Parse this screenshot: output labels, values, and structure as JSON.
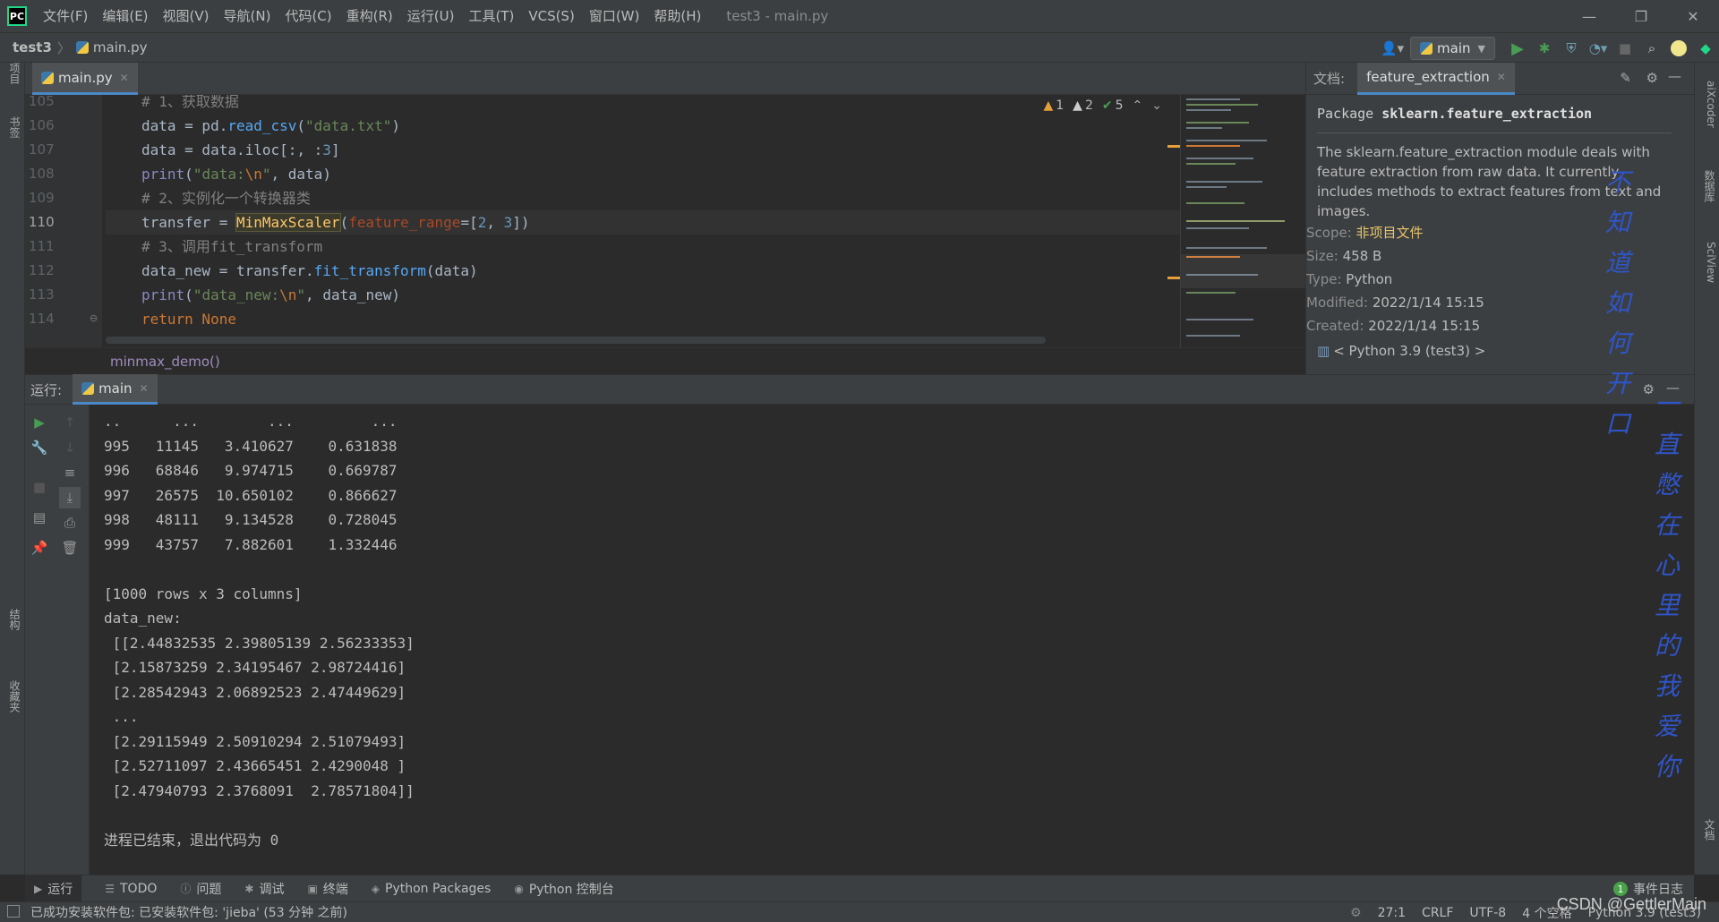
{
  "menubar": {
    "logo_text": "PC",
    "items": [
      "文件(F)",
      "编辑(E)",
      "视图(V)",
      "导航(N)",
      "代码(C)",
      "重构(R)",
      "运行(U)",
      "工具(T)",
      "VCS(S)",
      "窗口(W)",
      "帮助(H)"
    ],
    "window_title": "test3 - main.py",
    "controls": [
      "—",
      "❐",
      "✕"
    ]
  },
  "navbar": {
    "project": "test3",
    "file": "main.py",
    "run_config": "main"
  },
  "left_strip": {
    "tabs": [
      "项目",
      "书签",
      "结构",
      "收藏夹"
    ]
  },
  "right_strip": {
    "tabs": [
      "aiXcoder",
      "数据库",
      "SciView",
      "文档"
    ]
  },
  "editor": {
    "tab_label": "main.py",
    "line_numbers": [
      "105",
      "106",
      "107",
      "108",
      "109",
      "110",
      "111",
      "112",
      "113",
      "114"
    ],
    "active_line": "110",
    "inspections": {
      "warnings": "1",
      "weak_warnings": "2",
      "typos": "5"
    },
    "function_breadcrumb": "minmax_demo()"
  },
  "doc_panel": {
    "header_label": "文档:",
    "tab_label": "feature_extraction",
    "package_prefix": "Package",
    "package_name": "sklearn.feature_extraction",
    "description": "The sklearn.feature_extraction module deals with feature extraction from raw data. It currently includes methods to extract features from text and images.",
    "scope_label": "Scope:",
    "scope_value": "非项目文件",
    "size_label": "Size:",
    "size_value": "458 B",
    "type_label": "Type:",
    "type_value": "Python",
    "modified_label": "Modified:",
    "modified_value": "2022/1/14 15:15",
    "created_label": "Created:",
    "created_value": "2022/1/14 15:15",
    "sdk": "< Python 3.9 (test3) >"
  },
  "run_panel": {
    "label": "运行:",
    "tab_label": "main",
    "console_lines": [
      "..      ...        ...         ...",
      "995   11145   3.410627    0.631838",
      "996   68846   9.974715    0.669787",
      "997   26575  10.650102    0.866627",
      "998   48111   9.134528    0.728045",
      "999   43757   7.882601    1.332446",
      "",
      "[1000 rows x 3 columns]",
      "data_new:",
      " [[2.44832535 2.39805139 2.56233353]",
      " [2.15873259 2.34195467 2.98724416]",
      " [2.28542943 2.06892523 2.47449629]",
      " ...",
      " [2.29115949 2.50910294 2.51079493]",
      " [2.52711097 2.43665451 2.4290048 ]",
      " [2.47940793 2.3768091  2.78571804]]",
      "",
      "进程已结束，退出代码为 0"
    ]
  },
  "overlay_text": {
    "column1": [
      "不",
      "知",
      "道",
      "如",
      "何",
      "开",
      "口"
    ],
    "column2": [
      "一",
      "直",
      "憋",
      "在",
      "心",
      "里",
      "的",
      "我",
      "爱",
      "你"
    ]
  },
  "bottom_tabs": [
    "运行",
    "TODO",
    "问题",
    "调试",
    "终端",
    "Python Packages",
    "Python 控制台"
  ],
  "event_log": {
    "count": "1",
    "label": "事件日志"
  },
  "statusbar": {
    "message": "已成功安装软件包: 已安装软件包: 'jieba' (53 分钟 之前)",
    "position": "27:1",
    "line_sep": "CRLF",
    "encoding": "UTF-8",
    "indent": "4 个空格",
    "interpreter": "Python 3.9 (test3)"
  },
  "watermark": "CSDN @GettlerMain",
  "colors": {
    "accent": "#4a88c7",
    "run_green": "#499c54",
    "warning": "#e5a03a"
  }
}
